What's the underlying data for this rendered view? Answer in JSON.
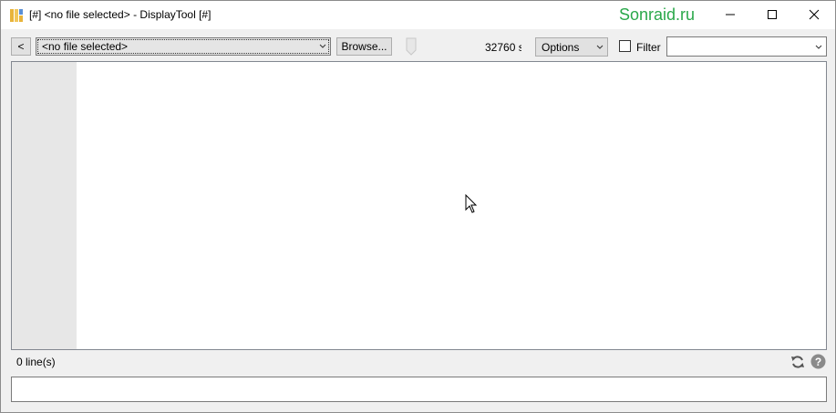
{
  "window": {
    "title": "[#] <no file selected> - DisplayTool [#]",
    "watermark": "Sonraid.ru"
  },
  "toolbar": {
    "back_label": "<",
    "file_combo_value": "<no file selected>",
    "browse_label": "Browse...",
    "count_text": "32760 s",
    "options_label": "Options",
    "filter_label": "Filter",
    "filter_checked": false,
    "filter_value": ""
  },
  "status": {
    "lines_text": "0 line(s)"
  },
  "bottom_input": {
    "value": ""
  },
  "colors": {
    "watermark": "#2aa84a",
    "gutter": "#e7e7e7",
    "help_icon": "#8a8a8a"
  },
  "icons": {
    "app": "app-grid-icon",
    "refresh": "refresh-icon",
    "help": "help-icon",
    "cursor": "mouse-pointer-icon"
  }
}
